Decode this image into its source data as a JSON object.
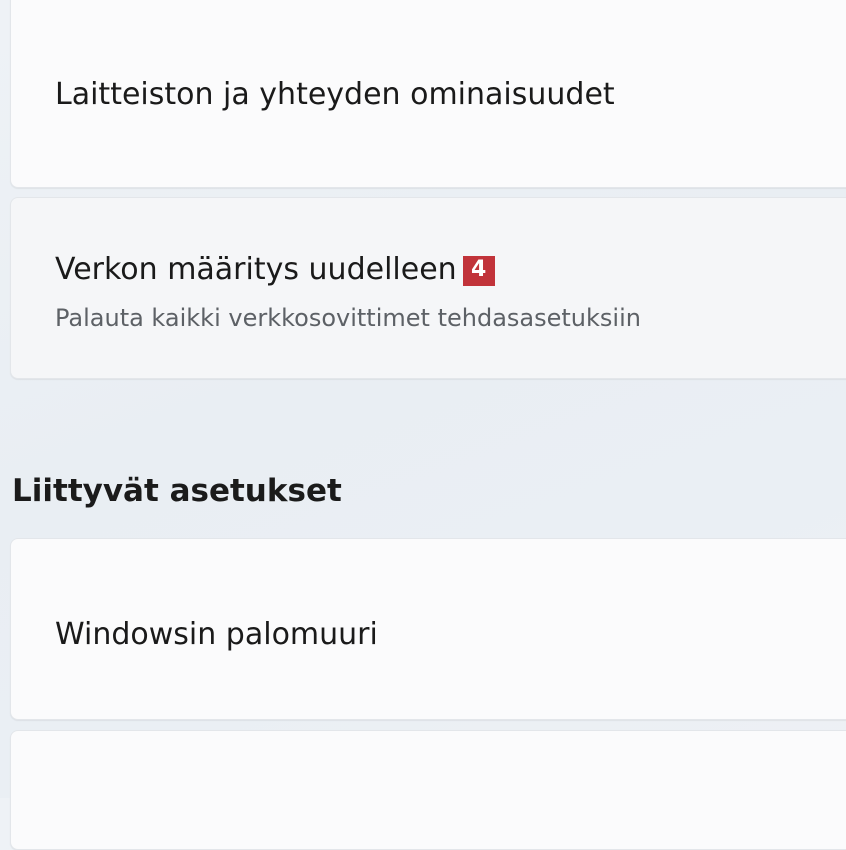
{
  "cards": {
    "hardware": {
      "title": "Laitteiston ja yhteyden ominaisuudet"
    },
    "network_reset": {
      "title": "Verkon määritys uudelleen",
      "badge": "4",
      "subtitle": "Palauta kaikki verkkosovittimet tehdasasetuksiin"
    }
  },
  "related_settings": {
    "heading": "Liittyvät asetukset",
    "items": [
      {
        "title": "Windowsin palomuuri"
      },
      {
        "title": ""
      }
    ]
  }
}
